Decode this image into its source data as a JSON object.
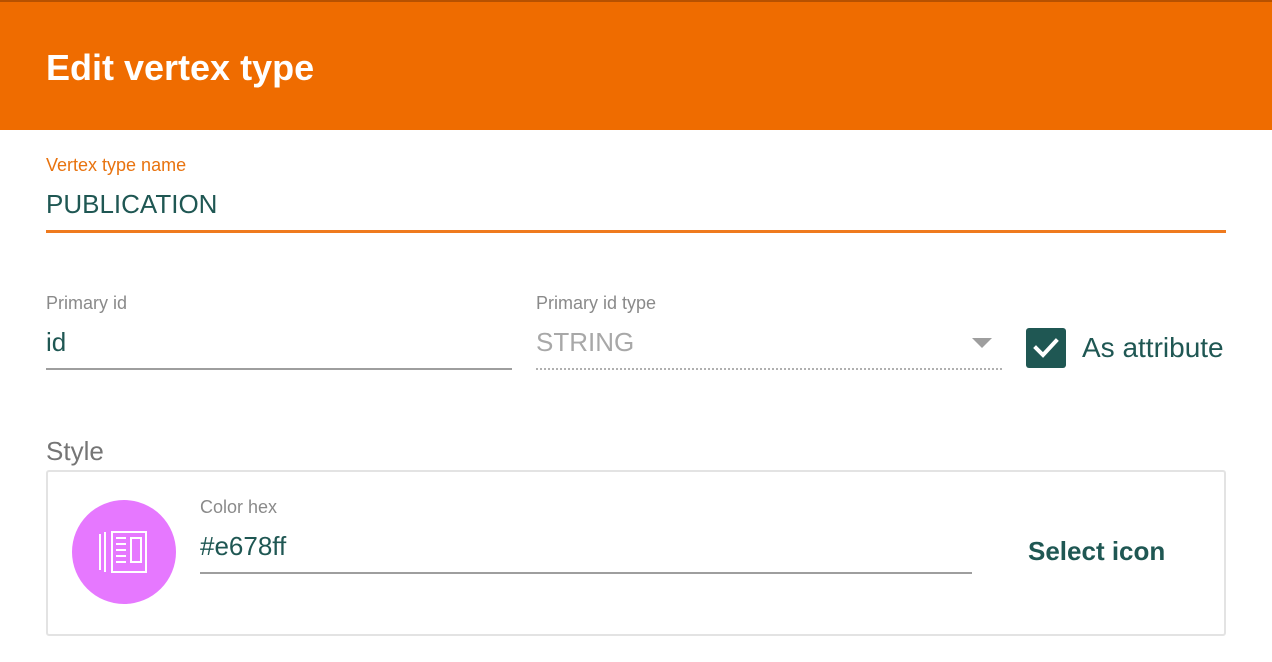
{
  "header": {
    "title": "Edit vertex type"
  },
  "vertex_name": {
    "label": "Vertex type name",
    "value": "PUBLICATION"
  },
  "primary_id": {
    "label": "Primary id",
    "value": "id"
  },
  "primary_id_type": {
    "label": "Primary id type",
    "selected": "STRING"
  },
  "as_attribute": {
    "label": "As attribute",
    "checked": true
  },
  "style": {
    "label": "Style",
    "color_label": "Color hex",
    "color_value": "#e678ff",
    "icon_name": "book-icon",
    "select_icon_label": "Select icon"
  },
  "colors": {
    "accent": "#ef6c00",
    "primary": "#1f5753",
    "vertex_color": "#e678ff"
  }
}
